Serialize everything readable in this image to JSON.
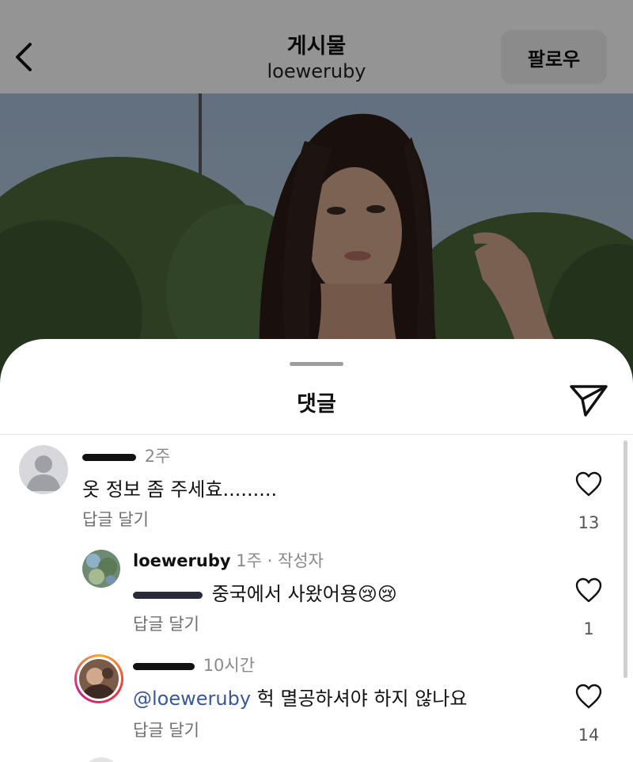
{
  "header": {
    "title": "게시물",
    "username": "loeweruby",
    "follow_label": "팔로우"
  },
  "sheet": {
    "title": "댓글"
  },
  "comments": [
    {
      "time": "2주",
      "text": "옷 정보 좀 주세효.........",
      "reply_label": "답글 달기",
      "likes": "13"
    },
    {
      "username": "loeweruby",
      "time": "1주",
      "author_badge": "· 작성자",
      "text": "중국에서 사왔어용😢😢",
      "reply_label": "답글 달기",
      "likes": "1"
    },
    {
      "time": "10시간",
      "mention": "@loeweruby",
      "text": " 헉 멸공하셔야 하지 않나요",
      "reply_label": "답글 달기",
      "likes": "14"
    }
  ],
  "icons": {
    "back": "chevron-left-icon",
    "share": "paper-plane-icon",
    "like": "heart-outline-icon"
  },
  "colors": {
    "mention": "#385898",
    "overlay": "rgba(0,0,0,0.42)"
  }
}
